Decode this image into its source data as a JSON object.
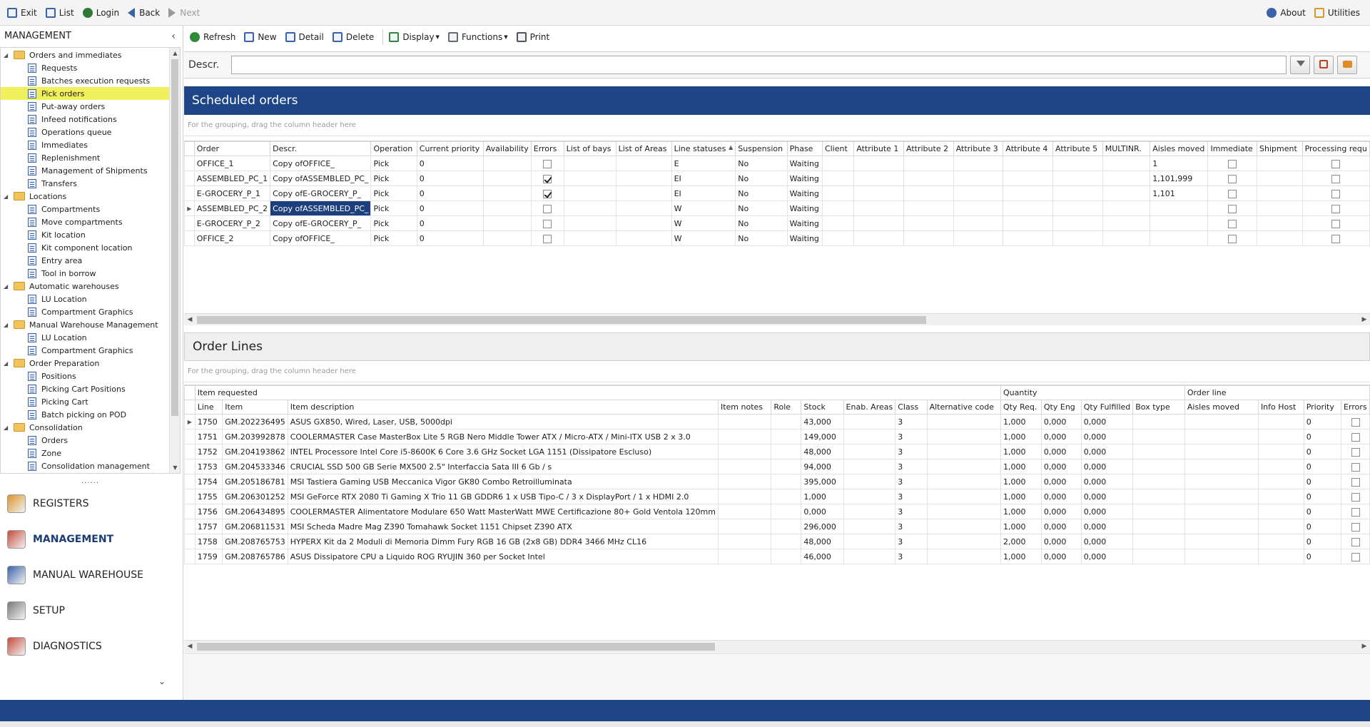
{
  "topbar": {
    "left": [
      {
        "label": "Exit",
        "icon": "exit-icon",
        "name": "exit"
      },
      {
        "label": "List",
        "icon": "list-icon",
        "name": "list"
      },
      {
        "label": "Login",
        "icon": "user-icon",
        "name": "login"
      },
      {
        "label": "Back",
        "icon": "arrow-left-icon",
        "name": "back"
      },
      {
        "label": "Next",
        "icon": "arrow-right-icon",
        "name": "next",
        "disabled": true
      }
    ],
    "right": [
      {
        "label": "About",
        "icon": "info-icon",
        "name": "about"
      },
      {
        "label": "Utilities",
        "icon": "utilities-icon",
        "name": "utilities"
      }
    ]
  },
  "sidebar": {
    "title": "MANAGEMENT",
    "tree": [
      {
        "label": "Orders and immediates",
        "children": [
          "Requests",
          "Batches execution requests",
          "Pick orders",
          "Put-away orders",
          "Infeed notifications",
          "Operations queue",
          "Immediates",
          "Replenishment",
          "Management of Shipments",
          "Transfers"
        ]
      },
      {
        "label": "Locations",
        "children": [
          "Compartments",
          "Move compartments",
          "Kit location",
          "Kit component location",
          "Entry area",
          "Tool in borrow"
        ]
      },
      {
        "label": "Automatic warehouses",
        "children": [
          "LU Location",
          "Compartment Graphics"
        ]
      },
      {
        "label": "Manual Warehouse Management",
        "children": [
          "LU Location",
          "Compartment Graphics"
        ]
      },
      {
        "label": "Order Preparation",
        "children": [
          "Positions",
          "Picking Cart Positions",
          "Picking Cart",
          "Batch picking on POD"
        ]
      },
      {
        "label": "Consolidation",
        "children": [
          "Orders",
          "Zone",
          "Consolidation management"
        ]
      }
    ],
    "selected": "Pick orders",
    "splitter": "......",
    "nav": [
      {
        "label": "REGISTERS",
        "icon": "registers-icon"
      },
      {
        "label": "MANAGEMENT",
        "icon": "management-icon",
        "active": true
      },
      {
        "label": "MANUAL WAREHOUSE",
        "icon": "manual-warehouse-icon"
      },
      {
        "label": "SETUP",
        "icon": "setup-icon"
      },
      {
        "label": "DIAGNOSTICS",
        "icon": "diagnostics-icon"
      }
    ]
  },
  "toolbar": [
    {
      "label": "Refresh",
      "icon": "refresh-icon"
    },
    {
      "label": "New",
      "icon": "new-icon"
    },
    {
      "label": "Detail",
      "icon": "edit-icon"
    },
    {
      "label": "Delete",
      "icon": "delete-icon"
    },
    {
      "label": "Display",
      "icon": "display-icon",
      "dropdown": true
    },
    {
      "label": "Functions",
      "icon": "functions-icon",
      "dropdown": true
    },
    {
      "label": "Print",
      "icon": "print-icon"
    }
  ],
  "filter": {
    "label": "Descr.",
    "value": ""
  },
  "orders": {
    "title": "Scheduled orders",
    "group_hint": "For the grouping, drag the column header here",
    "columns": [
      "Order",
      "Descr.",
      "Operation",
      "Current priority",
      "Availability",
      "Errors",
      "List of bays",
      "List of Areas",
      "Line statuses",
      "Suspension",
      "Phase",
      "Client",
      "Attribute 1",
      "Attribute 2",
      "Attribute 3",
      "Attribute 4",
      "Attribute 5",
      "MULTINR.",
      "Aisles moved",
      "Immediate",
      "Shipment",
      "Processing requ"
    ],
    "sorted_column": "Line statuses",
    "rows": [
      {
        "order": "OFFICE_1",
        "descr": "Copy ofOFFICE_",
        "operation": "Pick",
        "priority": "0",
        "errors": false,
        "line_statuses": "E",
        "suspension": "No",
        "phase": "Waiting",
        "aisles_moved": "1"
      },
      {
        "order": "ASSEMBLED_PC_1",
        "descr": "Copy ofASSEMBLED_PC_",
        "operation": "Pick",
        "priority": "0",
        "errors": true,
        "line_statuses": "EI",
        "suspension": "No",
        "phase": "Waiting",
        "aisles_moved": "1,101,999"
      },
      {
        "order": "E-GROCERY_P_1",
        "descr": "Copy ofE-GROCERY_P_",
        "operation": "Pick",
        "priority": "0",
        "errors": true,
        "line_statuses": "EI",
        "suspension": "No",
        "phase": "Waiting",
        "aisles_moved": "1,101"
      },
      {
        "order": "ASSEMBLED_PC_2",
        "descr": "Copy ofASSEMBLED_PC_",
        "operation": "Pick",
        "priority": "0",
        "errors": false,
        "line_statuses": "W",
        "suspension": "No",
        "phase": "Waiting",
        "aisles_moved": "",
        "current": true
      },
      {
        "order": "E-GROCERY_P_2",
        "descr": "Copy ofE-GROCERY_P_",
        "operation": "Pick",
        "priority": "0",
        "errors": false,
        "line_statuses": "W",
        "suspension": "No",
        "phase": "Waiting",
        "aisles_moved": ""
      },
      {
        "order": "OFFICE_2",
        "descr": "Copy ofOFFICE_",
        "operation": "Pick",
        "priority": "0",
        "errors": false,
        "line_statuses": "W",
        "suspension": "No",
        "phase": "Waiting",
        "aisles_moved": ""
      }
    ]
  },
  "lines": {
    "title": "Order Lines",
    "group_hint": "For the grouping, drag the column header here",
    "bands": [
      "Item requested",
      "Quantity",
      "Order line"
    ],
    "columns": [
      "Line",
      "Item",
      "Item description",
      "Item notes",
      "Role",
      "Stock",
      "Enab. Areas",
      "Class",
      "Alternative code",
      "Qty Req.",
      "Qty Eng",
      "Qty Fulfilled",
      "Box type",
      "Aisles moved",
      "Info Host",
      "Priority",
      "Errors"
    ],
    "rows": [
      {
        "line": "1750",
        "item": "GM.202236495",
        "desc": "ASUS GX850, Wired, Laser, USB, 5000dpi",
        "stock": "43,000",
        "class": "3",
        "qty_req": "1,000",
        "qty_eng": "0,000",
        "qty_ful": "0,000",
        "priority": "0",
        "current": true
      },
      {
        "line": "1751",
        "item": "GM.203992878",
        "desc": "COOLERMASTER Case MasterBox Lite 5 RGB Nero Middle Tower ATX / Micro-ATX / Mini-ITX USB 2 x 3.0",
        "stock": "149,000",
        "class": "3",
        "qty_req": "1,000",
        "qty_eng": "0,000",
        "qty_ful": "0,000",
        "priority": "0"
      },
      {
        "line": "1752",
        "item": "GM.204193862",
        "desc": "INTEL Processore Intel Core i5-8600K 6 Core 3.6 GHz Socket LGA 1151 (Dissipatore Escluso)",
        "stock": "48,000",
        "class": "3",
        "qty_req": "1,000",
        "qty_eng": "0,000",
        "qty_ful": "0,000",
        "priority": "0"
      },
      {
        "line": "1753",
        "item": "GM.204533346",
        "desc": "CRUCIAL SSD 500 GB Serie MX500 2.5\" Interfaccia Sata III 6 Gb / s",
        "stock": "94,000",
        "class": "3",
        "qty_req": "1,000",
        "qty_eng": "0,000",
        "qty_ful": "0,000",
        "priority": "0"
      },
      {
        "line": "1754",
        "item": "GM.205186781",
        "desc": "MSI Tastiera Gaming USB Meccanica Vigor GK80 Combo Retroilluminata",
        "stock": "395,000",
        "class": "3",
        "qty_req": "1,000",
        "qty_eng": "0,000",
        "qty_ful": "0,000",
        "priority": "0"
      },
      {
        "line": "1755",
        "item": "GM.206301252",
        "desc": "MSI GeForce RTX 2080 Ti Gaming X Trio 11 GB GDDR6 1 x USB Tipo-C / 3 x DisplayPort / 1 x HDMI 2.0",
        "stock": "1,000",
        "class": "3",
        "qty_req": "1,000",
        "qty_eng": "0,000",
        "qty_ful": "0,000",
        "priority": "0"
      },
      {
        "line": "1756",
        "item": "GM.206434895",
        "desc": "COOLERMASTER Alimentatore Modulare 650 Watt MasterWatt MWE Certificazione 80+ Gold Ventola 120mm",
        "stock": "0,000",
        "class": "3",
        "qty_req": "1,000",
        "qty_eng": "0,000",
        "qty_ful": "0,000",
        "priority": "0"
      },
      {
        "line": "1757",
        "item": "GM.206811531",
        "desc": "MSI Scheda Madre Mag Z390 Tomahawk Socket 1151 Chipset Z390 ATX",
        "stock": "296,000",
        "class": "3",
        "qty_req": "1,000",
        "qty_eng": "0,000",
        "qty_ful": "0,000",
        "priority": "0"
      },
      {
        "line": "1758",
        "item": "GM.208765753",
        "desc": "HYPERX Kit da 2 Moduli di Memoria Dimm Fury RGB 16 GB (2x8 GB) DDR4 3466 MHz CL16",
        "stock": "48,000",
        "class": "3",
        "qty_req": "2,000",
        "qty_eng": "0,000",
        "qty_ful": "0,000",
        "priority": "0"
      },
      {
        "line": "1759",
        "item": "GM.208765786",
        "desc": "ASUS Dissipatore CPU a Liquido ROG RYUJIN 360 per Socket Intel",
        "stock": "46,000",
        "class": "3",
        "qty_req": "1,000",
        "qty_eng": "0,000",
        "qty_ful": "0,000",
        "priority": "0"
      }
    ]
  },
  "colors": {
    "accent": "#1d4587",
    "selection": "#f0ef5c",
    "cell_selected": "#1d3f7e"
  }
}
